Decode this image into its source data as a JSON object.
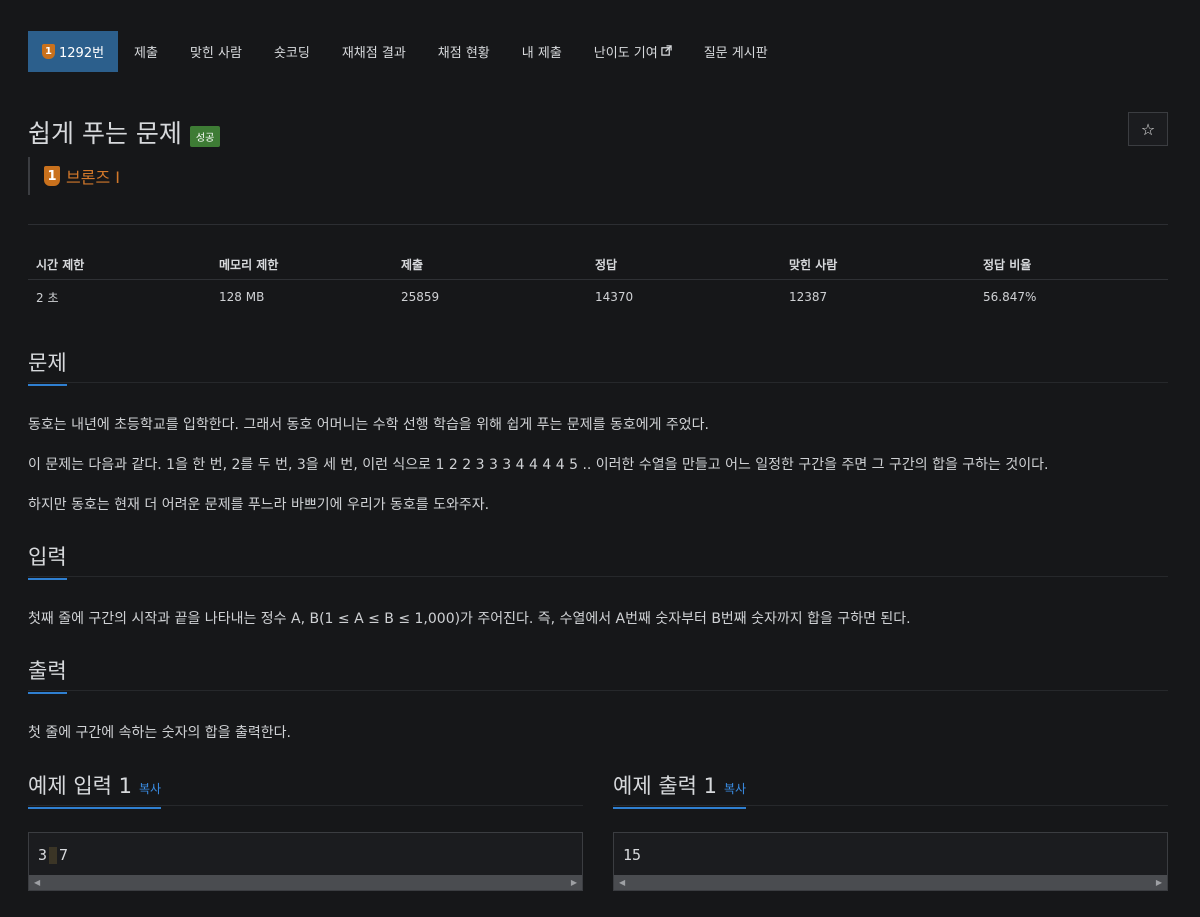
{
  "tabs": [
    {
      "label": "1292번",
      "active": true,
      "tier": "1"
    },
    {
      "label": "제출"
    },
    {
      "label": "맞힌 사람"
    },
    {
      "label": "숏코딩"
    },
    {
      "label": "재채점 결과"
    },
    {
      "label": "채점 현황"
    },
    {
      "label": "내 제출"
    },
    {
      "label": "난이도 기여",
      "external": true
    },
    {
      "label": "질문 게시판"
    }
  ],
  "problem": {
    "title": "쉽게 푸는 문제",
    "status_badge": "성공",
    "tier_number": "1",
    "tier_name": "브론즈 I",
    "star_icon": "☆"
  },
  "stats": {
    "headers": [
      "시간 제한",
      "메모리 제한",
      "제출",
      "정답",
      "맞힌 사람",
      "정답 비율"
    ],
    "values": [
      "2 초",
      "128 MB",
      "25859",
      "14370",
      "12387",
      "56.847%"
    ]
  },
  "sections": {
    "problem_heading": "문제",
    "problem_lines": [
      "동호는 내년에 초등학교를 입학한다. 그래서 동호 어머니는 수학 선행 학습을 위해 쉽게 푸는 문제를 동호에게 주었다.",
      "이 문제는 다음과 같다. 1을 한 번, 2를 두 번, 3을 세 번, 이런 식으로 1 2 2 3 3 3 4 4 4 4 5 .. 이러한 수열을 만들고 어느 일정한 구간을 주면 그 구간의 합을 구하는 것이다.",
      "하지만 동호는 현재 더 어려운 문제를 푸느라 바쁘기에 우리가 동호를 도와주자."
    ],
    "input_heading": "입력",
    "input_text": "첫째 줄에 구간의 시작과 끝을 나타내는 정수 A, B(1 ≤ A ≤ B ≤ 1,000)가 주어진다. 즉, 수열에서 A번째 숫자부터 B번째 숫자까지 합을 구하면 된다.",
    "output_heading": "출력",
    "output_text": "첫 줄에 구간에 속하는 숫자의 합을 출력한다."
  },
  "samples": {
    "input_heading": "예제 입력 1",
    "output_heading": "예제 출력 1",
    "copy_label": "복사",
    "input_left": "3",
    "input_right": "7",
    "output_value": "15",
    "scroll_left": "◀",
    "scroll_right": "▶"
  },
  "colors": {
    "background": "#161719",
    "tab_active": "#2c5f8c",
    "tier_bronze": "#c9711d",
    "success_badge": "#3e7c35",
    "heading_underline": "#2f7fd0",
    "link": "#3a8ee6"
  }
}
